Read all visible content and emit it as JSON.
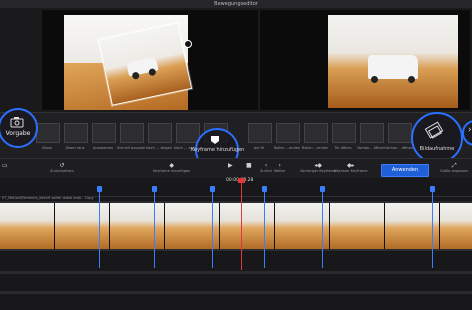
{
  "window": {
    "title": "Bewegungseditor"
  },
  "presets": {
    "items": [
      {
        "label": "Zoom"
      },
      {
        "label": "Zoom raus"
      },
      {
        "label": "Auszoomen"
      },
      {
        "label": "Schnell auszoom"
      },
      {
        "label": "Nach ... zeigen"
      },
      {
        "label": "Nach ... zeigen"
      },
      {
        "label": "Links-Rechts"
      },
      {
        "label": "Keyframe hinzufügen"
      },
      {
        "label": "Auf Hi"
      },
      {
        "label": "Rollen ...enden"
      },
      {
        "label": "Rollen ...enden"
      },
      {
        "label": "Tür öffnen"
      },
      {
        "label": "Vorhan... öffnen"
      },
      {
        "label": "Vorhan... öffnen"
      },
      {
        "label": "Bildaufnahme"
      }
    ]
  },
  "callouts": {
    "vorgabe": "Vorgabe",
    "keyframe": "Keyframe hinzufügen",
    "bildaufnahme": "Bildaufnahme"
  },
  "controls": {
    "undo": "Zurücksetzen",
    "add_keyframe": "Keyframe hinzufügen",
    "delete_keyframe": "Keyframe löschen",
    "play_prev": "Vorheriger",
    "stop": "Stop",
    "prev": "Zurück",
    "next": "Weiter",
    "prev_keyframe": "Vorheriger Keyframe",
    "next_keyframe": "Nächster Keyframe",
    "apply": "Anwenden",
    "zoom_fit": "Größe anpassen"
  },
  "timeline": {
    "timecode": "00:00:03.28",
    "clip_name": "07_Motion/Elements_desert safari dubai arab - Copy"
  },
  "colors": {
    "accent": "#2c6fff",
    "playhead": "#e0383b"
  }
}
